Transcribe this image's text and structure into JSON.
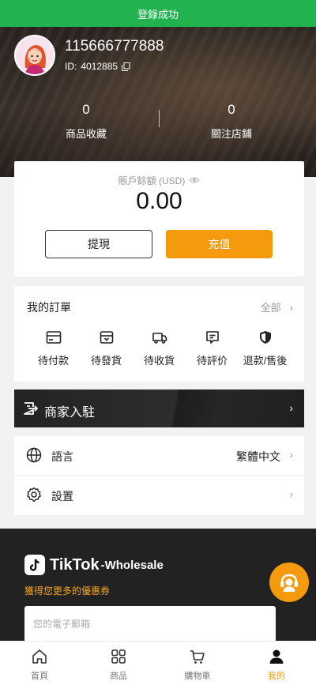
{
  "toast": {
    "message": "登錄成功"
  },
  "profile": {
    "phone": "115666777888",
    "id_label": "ID:",
    "id_value": "4012885"
  },
  "stats": [
    {
      "value": "0",
      "label": "商品收藏"
    },
    {
      "value": "0",
      "label": "關注店鋪"
    }
  ],
  "balance": {
    "label": "賬戶餘額 (USD)",
    "value": "0.00",
    "withdraw_label": "提現",
    "recharge_label": "充值"
  },
  "orders": {
    "title": "我的訂單",
    "all_label": "全部",
    "items": [
      {
        "label": "待付款",
        "icon": "card-icon"
      },
      {
        "label": "待發貨",
        "icon": "box-icon"
      },
      {
        "label": "待收貨",
        "icon": "truck-icon"
      },
      {
        "label": "待評价",
        "icon": "comment-icon"
      },
      {
        "label": "退款/售後",
        "icon": "shield-icon"
      }
    ]
  },
  "merchant": {
    "label": "商家入駐"
  },
  "settings": {
    "language_label": "語言",
    "language_value": "繁體中文",
    "settings_label": "設置"
  },
  "footer": {
    "brand": "TikTok",
    "brand_suffix": "-Wholesale",
    "tagline": "獲得您更多的優惠券",
    "email_placeholder": "您的電子郵箱"
  },
  "tabbar": [
    {
      "label": "首頁",
      "icon": "home-icon",
      "active": false
    },
    {
      "label": "商品",
      "icon": "grid-icon",
      "active": false
    },
    {
      "label": "購物車",
      "icon": "cart-icon",
      "active": false
    },
    {
      "label": "我的",
      "icon": "person-icon",
      "active": true
    }
  ],
  "colors": {
    "accent": "#f59a0c",
    "toast": "#22b34f",
    "dark": "#222222"
  }
}
